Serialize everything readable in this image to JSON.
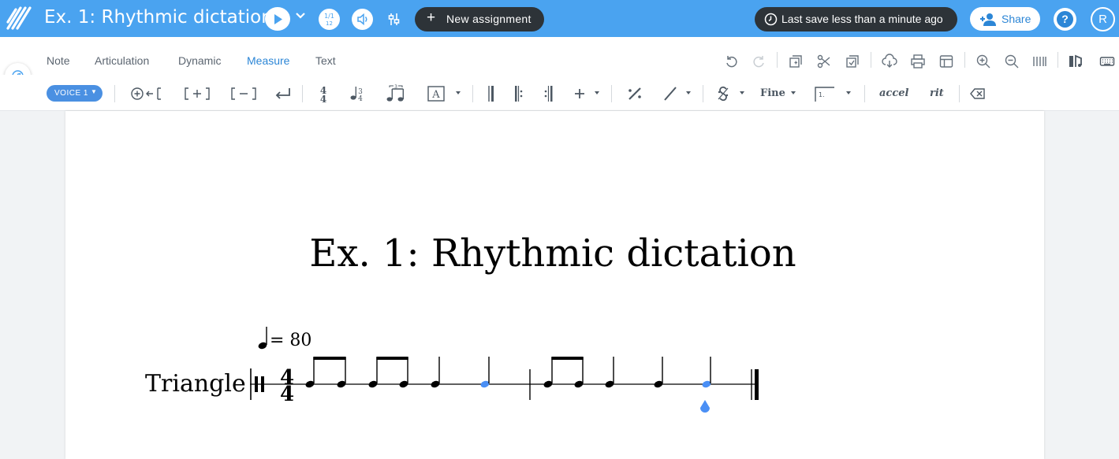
{
  "header": {
    "doc_title": "Ex. 1: Rhythmic dictation",
    "new_assignment": "New assignment",
    "save_status": "Last save less than a minute ago",
    "share": "Share",
    "help": "?",
    "avatar_initial": "R"
  },
  "tabs": [
    "Note",
    "Articulation",
    "Dynamic",
    "Measure",
    "Text"
  ],
  "active_tab": "Measure",
  "toolbar": {
    "voice_label": "VOICE 1",
    "fine_label": "Fine",
    "accel_label": "accel",
    "rit_label": "rit"
  },
  "score": {
    "title": "Ex. 1: Rhythmic dictation",
    "tempo": "= 80",
    "instrument": "Triangle",
    "time_signature": "4/4"
  },
  "colors": {
    "brand_blue": "#4aa3f0",
    "accent": "#2c86d6",
    "dark_pill": "#2d3338",
    "selected_note": "#4a8ff5"
  }
}
